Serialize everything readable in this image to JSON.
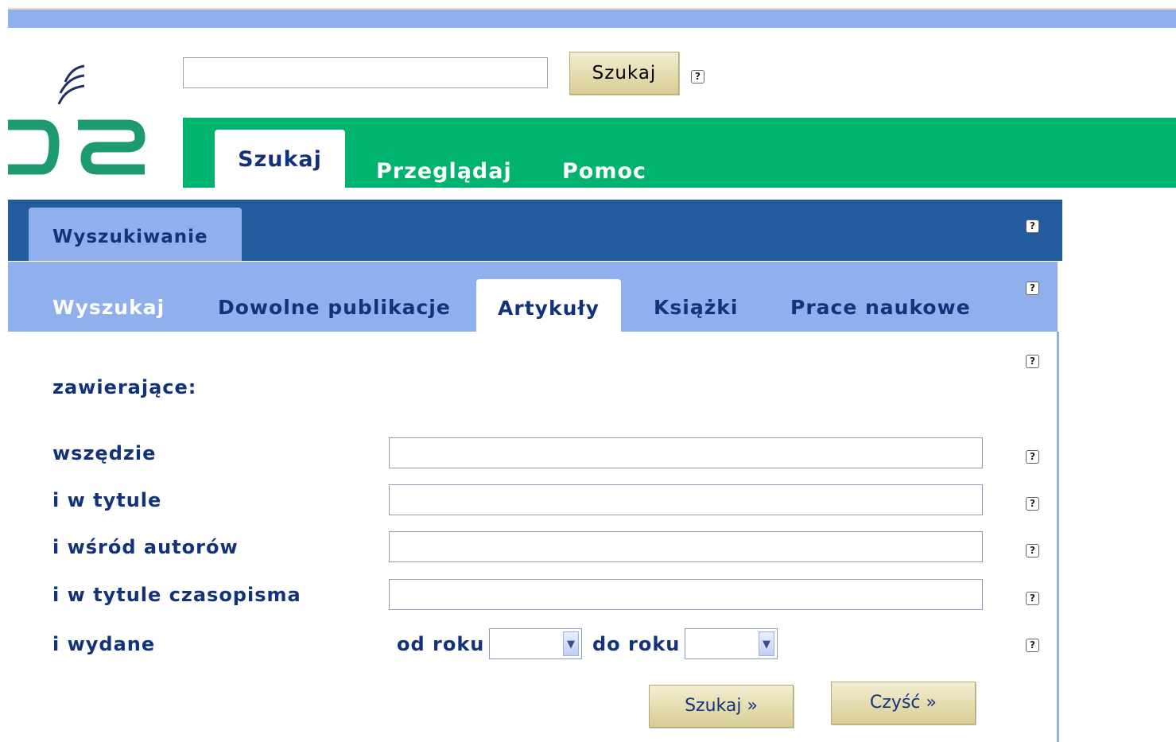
{
  "header": {
    "search": {
      "value": "",
      "placeholder": "",
      "button_label": "Szukaj"
    },
    "help_symbol": "?"
  },
  "main_tabs": [
    {
      "label": "Szukaj",
      "active": true
    },
    {
      "label": "Przeglądaj",
      "active": false
    },
    {
      "label": "Pomoc",
      "active": false
    }
  ],
  "panel": {
    "title_tab": "Wyszukiwanie",
    "sub_tabs": [
      {
        "label": "Wyszukaj",
        "active": false
      },
      {
        "label": "Dowolne publikacje",
        "active": false
      },
      {
        "label": "Artykuły",
        "active": true
      },
      {
        "label": "Książki",
        "active": false
      },
      {
        "label": "Prace naukowe",
        "active": false
      }
    ]
  },
  "form": {
    "heading": "zawierające:",
    "fields": [
      {
        "label": "wszędzie",
        "value": ""
      },
      {
        "label": "i w tytule",
        "value": ""
      },
      {
        "label": "i wśród autorów",
        "value": ""
      },
      {
        "label": "i w tytule czasopisma",
        "value": ""
      }
    ],
    "published": {
      "label": "i wydane",
      "from_label": "od roku",
      "from_value": "",
      "to_label": "do roku",
      "to_value": ""
    },
    "search_button": "Szukaj »",
    "clear_button": "Czyść »"
  },
  "colors": {
    "green": "#00b36e",
    "dark_blue": "#225c9d",
    "light_blue": "#8fb0ec",
    "text_blue": "#12327a"
  }
}
